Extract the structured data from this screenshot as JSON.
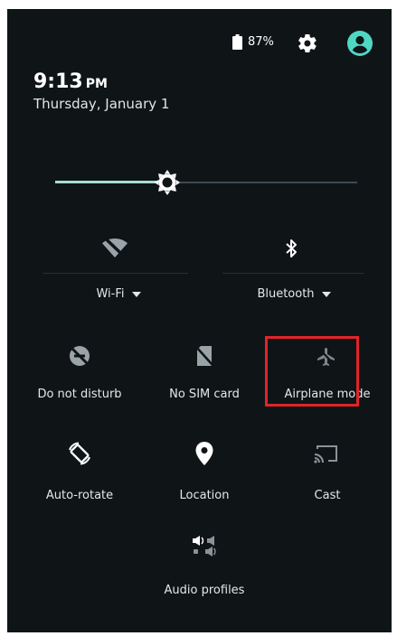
{
  "status": {
    "battery_percent": "87%",
    "icons": [
      "battery-icon",
      "settings-gear-icon",
      "account-circle-icon"
    ]
  },
  "clock": {
    "time": "9:13",
    "ampm": "PM",
    "date": "Thursday, January 1"
  },
  "brightness": {
    "level_fraction": 0.37
  },
  "wide_tiles": [
    {
      "label": "Wi-Fi",
      "icon": "wifi-off-icon"
    },
    {
      "label": "Bluetooth",
      "icon": "bluetooth-icon"
    }
  ],
  "tiles": [
    {
      "label": "Do not disturb",
      "icon": "do-not-disturb-icon"
    },
    {
      "label": "No SIM card",
      "icon": "no-sim-card-icon"
    },
    {
      "label": "Airplane mode",
      "icon": "airplane-icon"
    },
    {
      "label": "Auto-rotate",
      "icon": "auto-rotate-icon"
    },
    {
      "label": "Location",
      "icon": "location-pin-icon"
    },
    {
      "label": "Cast",
      "icon": "cast-icon"
    },
    {
      "label": "Audio profiles",
      "icon": "audio-profiles-icon"
    }
  ],
  "colors": {
    "panel_bg": "#0f1517",
    "slider_accent": "#a8ddd1",
    "highlight_box": "#e2232a"
  }
}
